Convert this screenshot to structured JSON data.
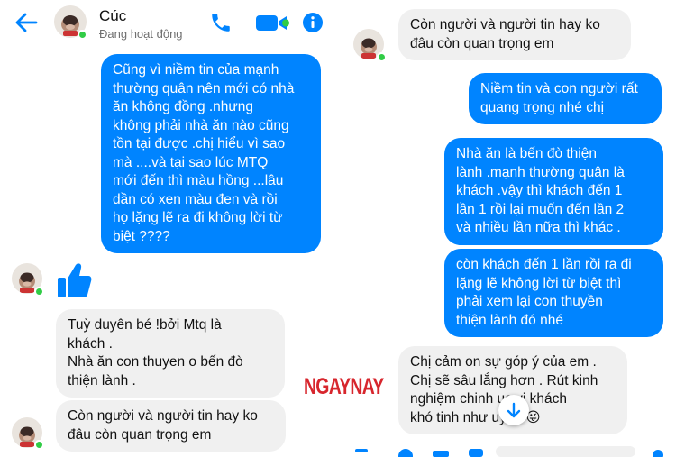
{
  "header": {
    "contact_name": "Cúc",
    "status": "Đang hoạt động",
    "icons": [
      "back-arrow-icon",
      "phone-icon",
      "video-call-icon",
      "info-icon"
    ]
  },
  "colors": {
    "accent": "#0084ff",
    "incoming_bubble": "#f0f0f0",
    "online": "#31cc46",
    "watermark": "#d7262d"
  },
  "left_messages": {
    "m1": "Cũng vì niềm tin của mạnh\nthường quân nên mới có nhà\năn không đồng .nhưng\nkhông phải nhà ăn nào cũng\ntồn tại được .chị hiểu vì sao\nmà ....và tại sao lúc MTQ\nmới đến thì màu hồng ...lâu\ndần có xen màu đen và rồi\nhọ lặng lẽ ra đi không lời từ\nbiệt ????",
    "m3": "Tuỳ duyên bé !bởi Mtq là\nkhách .\nNhà ăn con thuyen o bến đò\nthiện lành .",
    "m4": "Còn người và người tin hay ko\nđâu còn quan trọng em"
  },
  "right_messages": {
    "r1": "Còn người và người tin hay ko\nđâu còn quan trọng em",
    "r2": "Niềm tin và con người rất\nquang trọng nhé chị",
    "r3": "Nhà ăn là bến đò thiện\nlành .mạnh thường quân là\nkhách .vậy thì khách đến 1\nlần 1 rồi lại muốn đến lần 2\nvà nhiều lần nữa thì khác .",
    "r4": "còn khách đến 1 lần rồi ra đi\nlặng lẽ không lời từ biệt thì\nphải xem lại con thuyền\nthiện lành đó nhé",
    "r5": "Chị cảm on sự góp ý của em .\nChị sẽ sâu lắng hơn . Rút kinh\nnghiệm chinh    ục vị khách\nkhó tinh như    uyền 😜"
  },
  "watermark": "NGAYNAY"
}
